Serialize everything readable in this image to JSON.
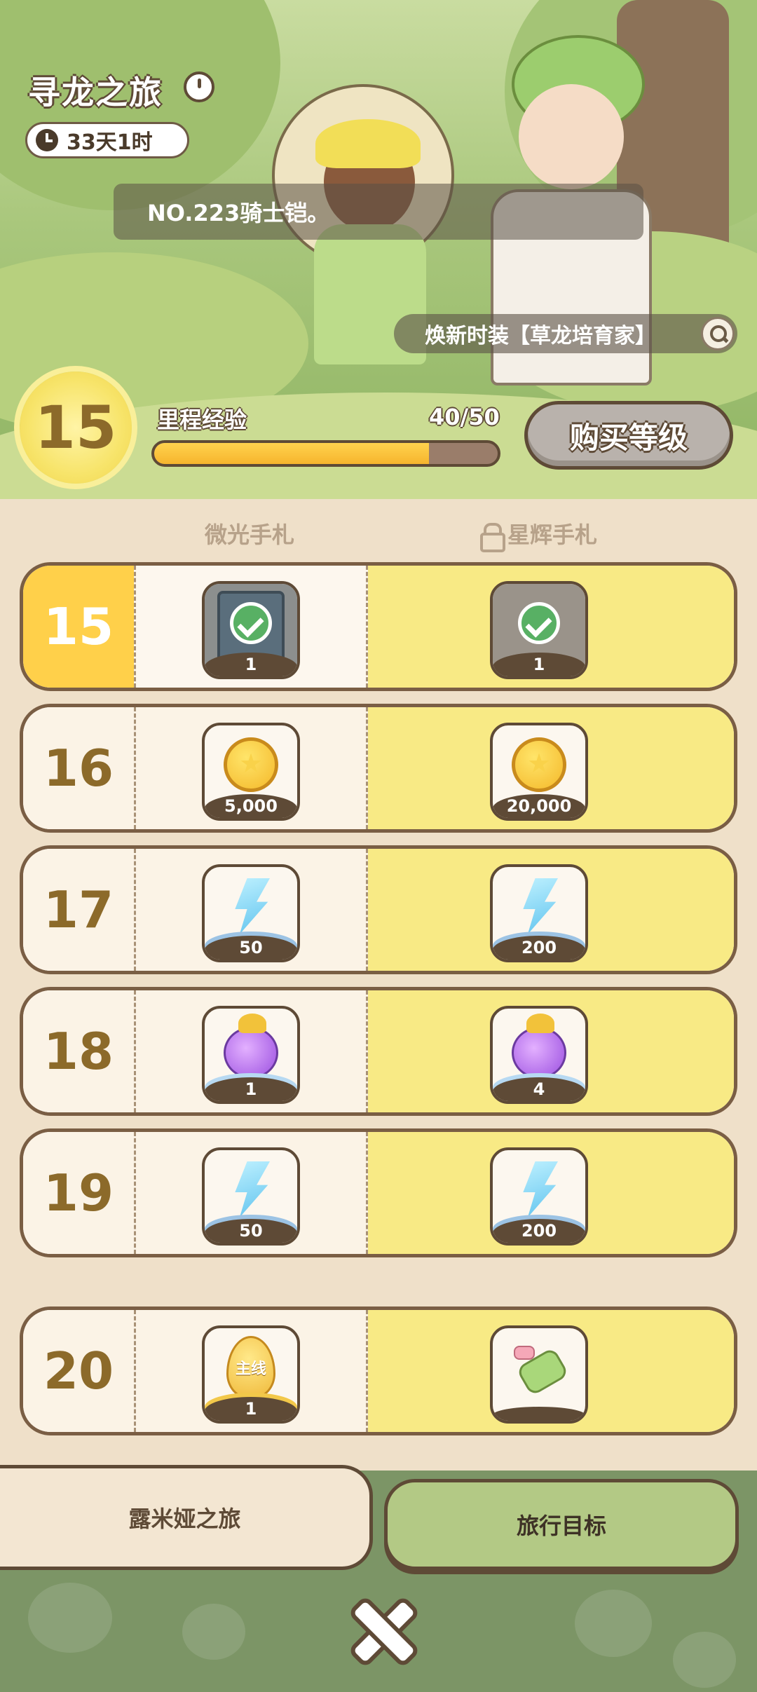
{
  "banner": {
    "title": "寻龙之旅",
    "timer": "33天1时",
    "ticker": "NO.223骑士铠。",
    "outfit": "焕新时装【草龙培育家】",
    "level": "15",
    "exp_label": "里程经验",
    "exp_value": "40/50",
    "exp_progress": 0.8,
    "buy_button": "购买等级"
  },
  "columns": {
    "free": "微光手札",
    "premium": "星辉手札",
    "premium_locked": true
  },
  "rows": [
    {
      "level": "15",
      "current": true,
      "free": {
        "icon": "card-check-icon",
        "qty": "1"
      },
      "premium": {
        "icon": "emblem-check-icon",
        "qty": "1"
      }
    },
    {
      "level": "16",
      "free": {
        "icon": "coin-icon",
        "qty": "5,000"
      },
      "premium": {
        "icon": "coin-icon",
        "qty": "20,000"
      }
    },
    {
      "level": "17",
      "free": {
        "icon": "energy-bolt-icon",
        "qty": "50"
      },
      "premium": {
        "icon": "energy-bolt-icon",
        "qty": "200"
      }
    },
    {
      "level": "18",
      "free": {
        "icon": "star-fruit-icon",
        "qty": "1"
      },
      "premium": {
        "icon": "star-fruit-icon",
        "qty": "4"
      }
    },
    {
      "level": "19",
      "free": {
        "icon": "energy-bolt-icon",
        "qty": "50"
      },
      "premium": {
        "icon": "energy-bolt-icon",
        "qty": "200"
      }
    },
    {
      "level": "20",
      "free": {
        "icon": "main-egg-icon",
        "label": "主线",
        "qty": "1"
      },
      "premium": {
        "icon": "glove-icon",
        "qty": ""
      }
    }
  ],
  "tabs": {
    "travel": "露米娅之旅",
    "goal": "旅行目标"
  },
  "colors": {
    "accent_yellow": "#ffd04a",
    "premium_bg": "#f8ea85",
    "outline_brown": "#5e4a36",
    "bottom_green": "#7c9566"
  }
}
